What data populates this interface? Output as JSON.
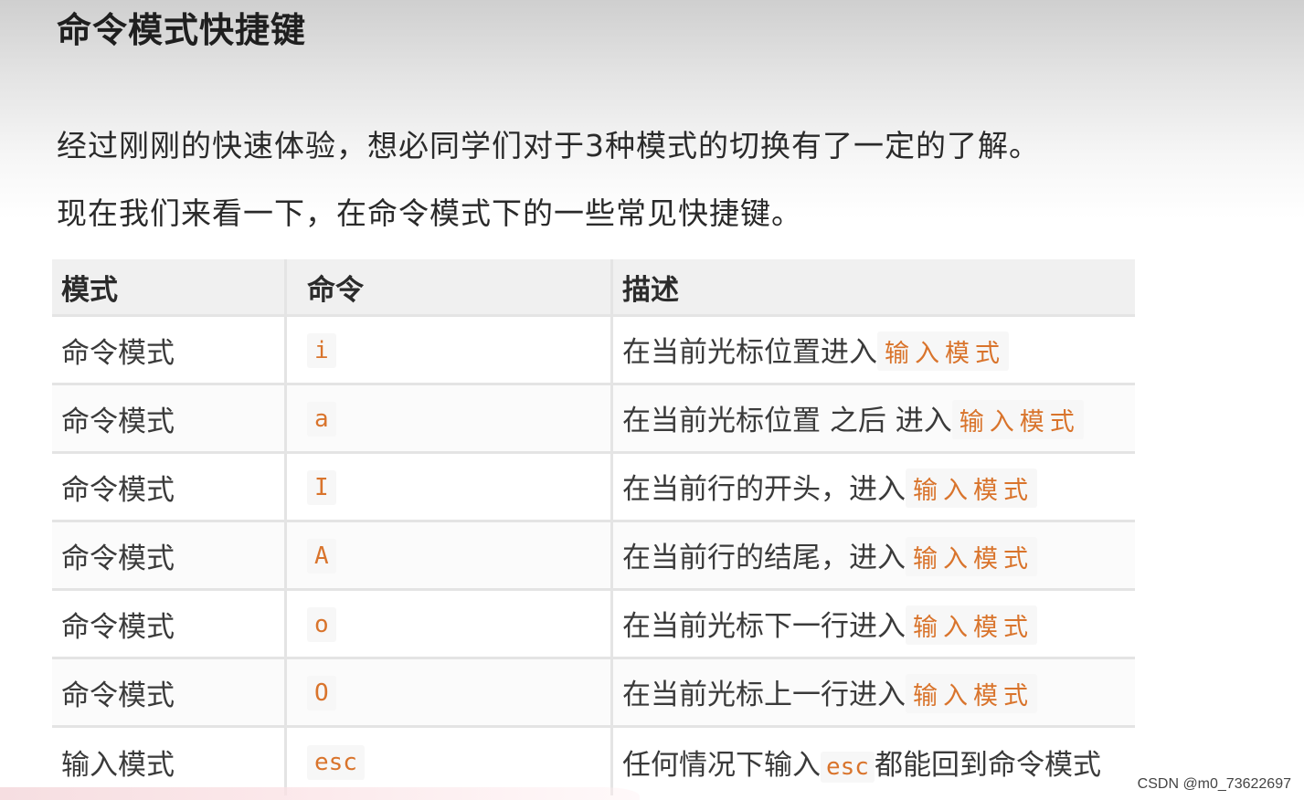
{
  "title": "命令模式快捷键",
  "paragraphs": [
    "经过刚刚的快速体验，想必同学们对于3种模式的切换有了一定的了解。",
    "现在我们来看一下，在命令模式下的一些常见快捷键。"
  ],
  "table": {
    "headers": [
      "模式",
      "命令",
      "描述"
    ],
    "rows": [
      {
        "mode": "命令模式",
        "cmd": "i",
        "desc": "在当前光标位置进入",
        "hl": "输入模式"
      },
      {
        "mode": "命令模式",
        "cmd": "a",
        "desc": "在当前光标位置 之后 进入",
        "hl": "输入模式"
      },
      {
        "mode": "命令模式",
        "cmd": "I",
        "desc": "在当前行的开头，进入",
        "hl": "输入模式"
      },
      {
        "mode": "命令模式",
        "cmd": "A",
        "desc": "在当前行的结尾，进入",
        "hl": "输入模式"
      },
      {
        "mode": "命令模式",
        "cmd": "o",
        "desc": "在当前光标下一行进入",
        "hl": "输入模式"
      },
      {
        "mode": "命令模式",
        "cmd": "O",
        "desc": "在当前光标上一行进入",
        "hl": "输入模式"
      },
      {
        "mode": "输入模式",
        "cmd": "esc",
        "desc_pre": "任何情况下输入",
        "desc_code": "esc",
        "desc_post": "都能回到命令模式"
      }
    ]
  },
  "watermark": "CSDN @m0_73622697",
  "colors": {
    "accent": "#d9742c"
  }
}
